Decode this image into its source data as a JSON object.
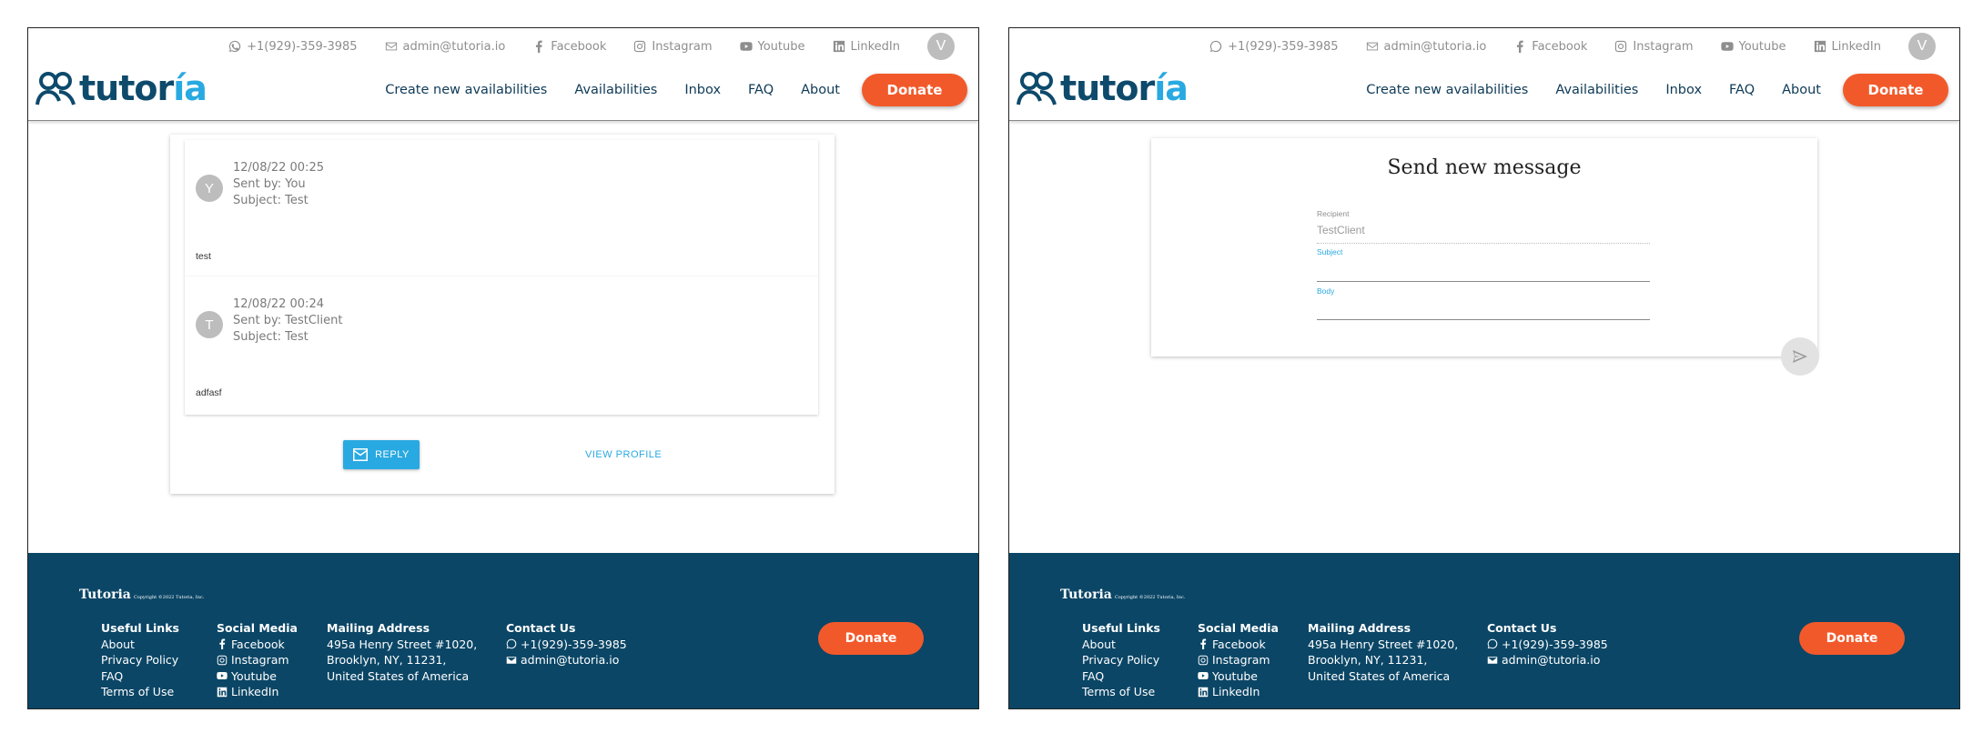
{
  "topbar": {
    "phone": "+1(929)-359-3985",
    "email": "admin@tutoria.io",
    "facebook": "Facebook",
    "instagram": "Instagram",
    "youtube": "Youtube",
    "linkedin": "LinkedIn",
    "user_initial": "V"
  },
  "nav": {
    "logo_main": "tutor",
    "logo_accent": "ía",
    "links": [
      "Create new availabilities",
      "Availabilities",
      "Inbox",
      "FAQ",
      "About"
    ],
    "donate": "Donate"
  },
  "thread": {
    "messages": [
      {
        "avatar": "Y",
        "date": "12/08/22 00:25",
        "sender": "Sent by: You",
        "subject": "Subject: Test",
        "body": "test"
      },
      {
        "avatar": "T",
        "date": "12/08/22 00:24",
        "sender": "Sent by: TestClient",
        "subject": "Subject: Test",
        "body": "adfasf"
      }
    ],
    "reply_label": "REPLY",
    "view_profile_label": "VIEW PROFILE"
  },
  "compose": {
    "title": "Send new message",
    "recipient_label": "Recipient",
    "recipient_value": "TestClient",
    "subject_label": "Subject",
    "subject_value": "",
    "body_label": "Body",
    "body_value": ""
  },
  "footer": {
    "brand": "Tutoria",
    "copyright": "Copyright ©2022 Tutoria, Inc.",
    "useful_links_heading": "Useful Links",
    "useful_links": [
      "About",
      "Privacy Policy",
      "FAQ",
      "Terms of Use"
    ],
    "social_heading": "Social Media",
    "social": [
      "Facebook",
      "Instagram",
      "Youtube",
      "LinkedIn"
    ],
    "mailing_heading": "Mailing Address",
    "mailing": [
      "495a Henry Street #1020,",
      "Brooklyn, NY, 11231,",
      "United States of America"
    ],
    "contact_heading": "Contact Us",
    "contact_phone": "+1(929)-359-3985",
    "contact_email": "admin@tutoria.io",
    "donate": "Donate"
  },
  "colors": {
    "brand_dark": "#0d4a6b",
    "brand_accent": "#29a9e1",
    "donate": "#f2592a",
    "footer_bg": "#0b4666"
  }
}
